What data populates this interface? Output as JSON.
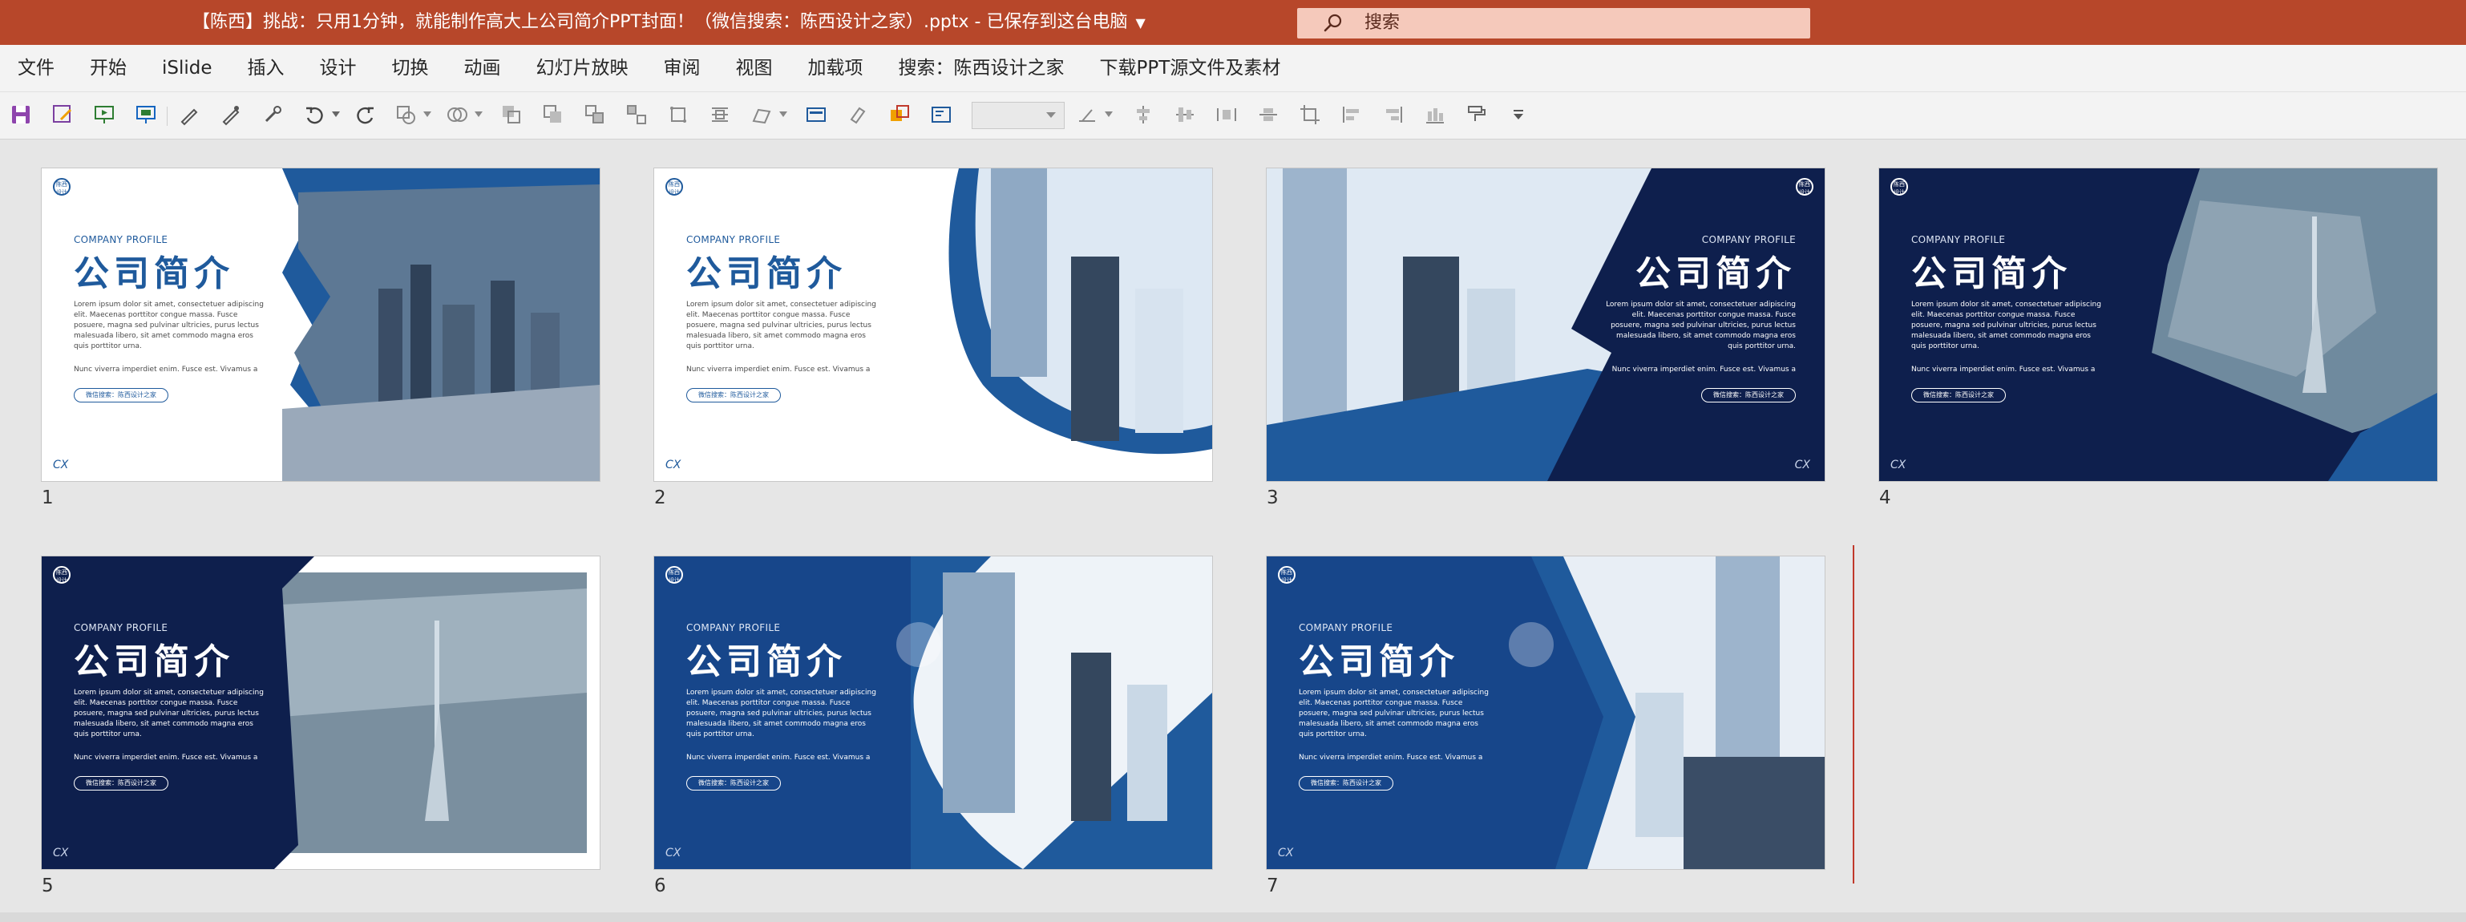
{
  "window": {
    "title": "【陈西】挑战：只用1分钟，就能制作高大上公司简介PPT封面！（微信搜索：陈西设计之家）.pptx  -  已保存到这台电脑",
    "search_placeholder": "搜索",
    "accent_color": "#b7472a"
  },
  "menu": {
    "tabs": [
      "文件",
      "开始",
      "iSlide",
      "插入",
      "设计",
      "切换",
      "动画",
      "幻灯片放映",
      "审阅",
      "视图",
      "加载项",
      "搜索：陈西设计之家",
      "下载PPT源文件及素材"
    ]
  },
  "toolbar": {
    "icons": [
      "save-icon",
      "save-as-icon",
      "present-icon",
      "present-from-current-icon",
      "pen-icon",
      "pen-alt-icon",
      "eyedropper-icon",
      "undo-icon",
      "redo-icon",
      "shape-icon",
      "merge-shapes-icon",
      "bring-forward-icon",
      "send-backward-icon",
      "group-icon",
      "ungroup-icon",
      "crop-icon",
      "align-icon",
      "format-icon",
      "paint-icon",
      "selection-icon",
      "font-size-combo",
      "rotate-icon",
      "align-left-icon",
      "align-center-icon",
      "align-right-icon",
      "distribute-icon",
      "crop-alt-icon",
      "distribute-h-icon",
      "distribute-v-icon",
      "format-painter-icon",
      "customize-icon"
    ]
  },
  "slide_text": {
    "subtitle": "COMPANY PROFILE",
    "title": "公司简介",
    "body": "Lorem ipsum dolor sit amet, consectetuer adipiscing elit. Maecenas porttitor congue massa. Fusce posuere, magna sed pulvinar ultricies, purus lectus malesuada libero, sit amet commodo magna eros quis porttitor urna.",
    "body2": "Nunc viverra imperdiet enim. Fusce est. Vivamus a",
    "pill": "微信搜索：陈西设计之家",
    "footer": "CX",
    "logo": "陈西设计"
  },
  "slides": [
    {
      "number": "1",
      "theme": "light"
    },
    {
      "number": "2",
      "theme": "light"
    },
    {
      "number": "3",
      "theme": "dark"
    },
    {
      "number": "4",
      "theme": "dark"
    },
    {
      "number": "5",
      "theme": "dark"
    },
    {
      "number": "6",
      "theme": "dark"
    },
    {
      "number": "7",
      "theme": "dark"
    }
  ],
  "colors": {
    "navy": "#0e1f4d",
    "blue": "#1f5a9c",
    "mid_blue": "#2c6bb8"
  }
}
